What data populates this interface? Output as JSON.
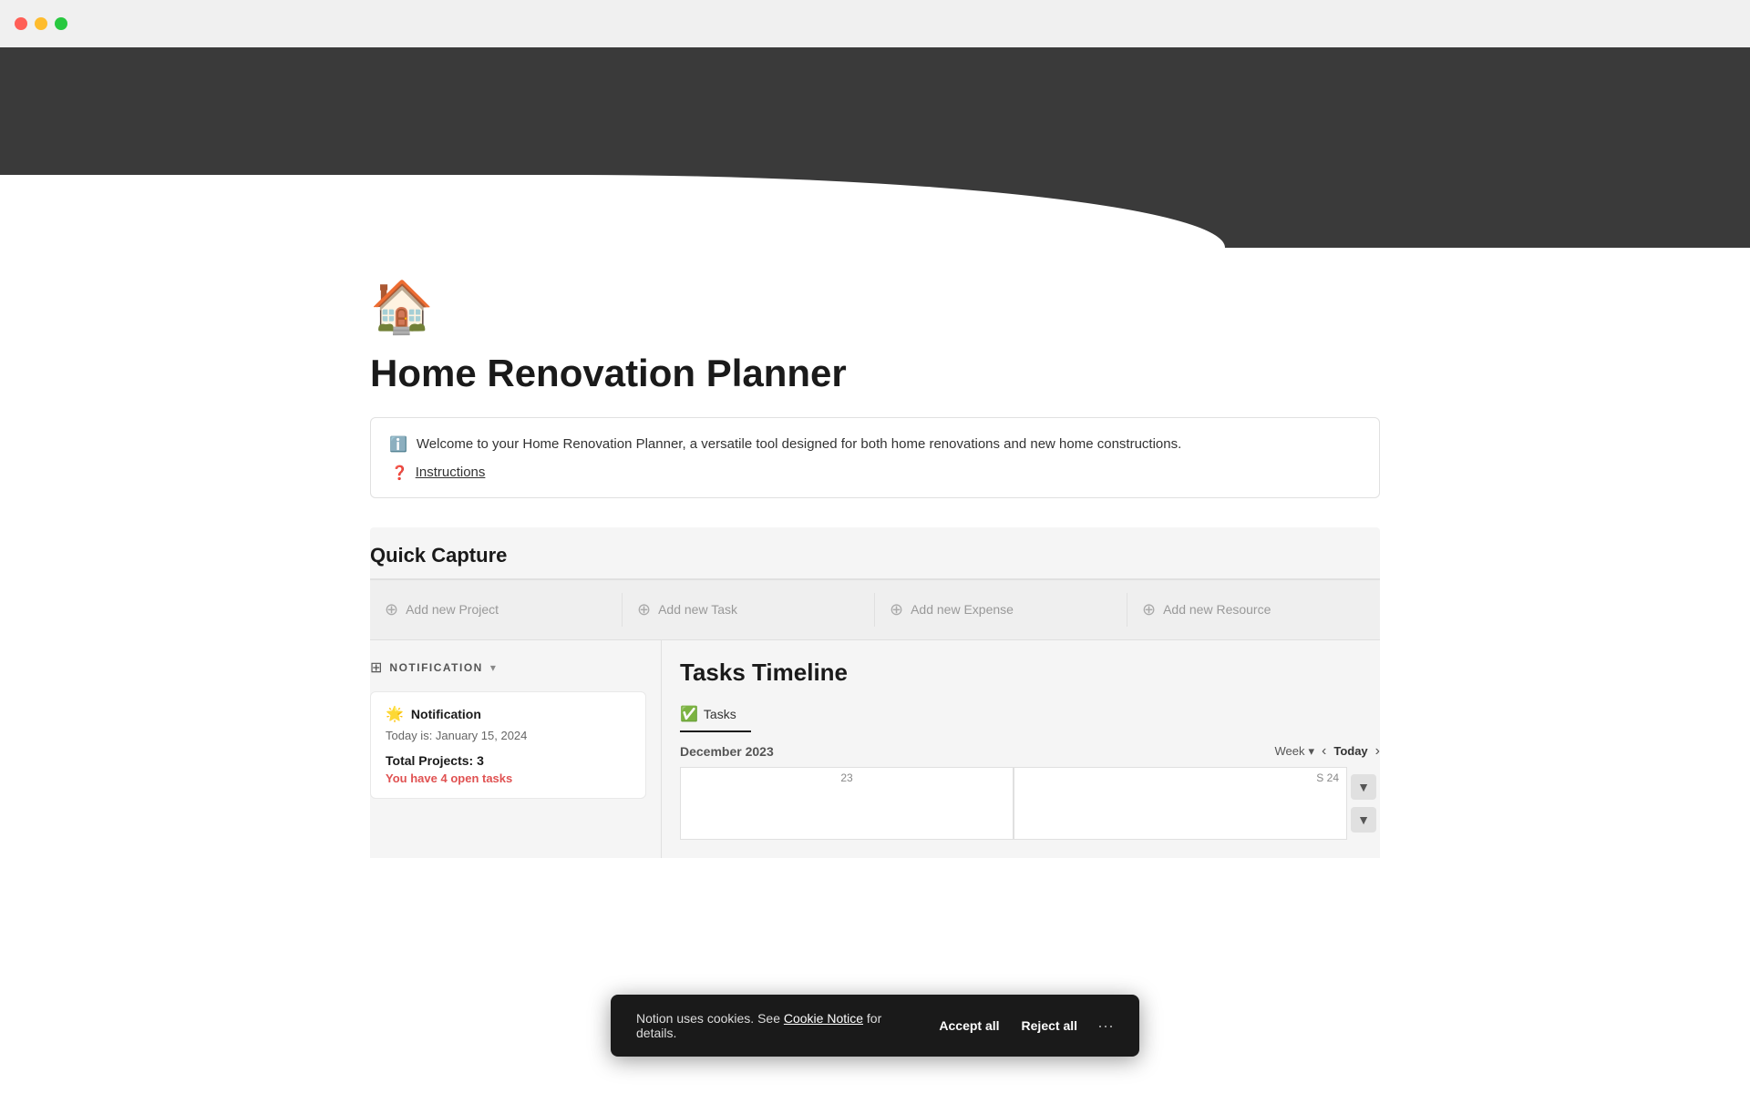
{
  "titleBar": {
    "trafficLights": [
      "red",
      "yellow",
      "green"
    ]
  },
  "pageIcon": "🏠",
  "pageTitle": "Home Renovation Planner",
  "infoBox": {
    "infoText": "Welcome to your Home Renovation Planner, a versatile tool designed for both home renovations and new home constructions.",
    "instructionsLabel": "Instructions"
  },
  "quickCapture": {
    "sectionTitle": "Quick Capture",
    "items": [
      {
        "label": "Add new Project"
      },
      {
        "label": "Add new Task"
      },
      {
        "label": "Add new Expense"
      },
      {
        "label": "Add new Resource"
      }
    ]
  },
  "notification": {
    "headerLabel": "NOTIFICATION",
    "card": {
      "sunIcon": "🌟",
      "title": "Notification",
      "dateLabel": "Today is: January 15, 2024",
      "totalProjectsLabel": "Total Projects: 3",
      "openTasksText": "You have",
      "openTasksCount": "4",
      "openTasksSuffix": "open tasks"
    }
  },
  "tasksTimeline": {
    "title": "Tasks Timeline",
    "tab": "Tasks",
    "monthLabel": "December 2023",
    "viewLabel": "Week",
    "todayLabel": "Today",
    "dayNumber": "23",
    "satLabel": "S",
    "satDay": "24"
  },
  "cookieBanner": {
    "text": "Notion uses cookies. See",
    "linkText": "Cookie Notice",
    "linkSuffix": "for details.",
    "acceptLabel": "Accept all",
    "rejectLabel": "Reject all",
    "moreIcon": "···"
  }
}
